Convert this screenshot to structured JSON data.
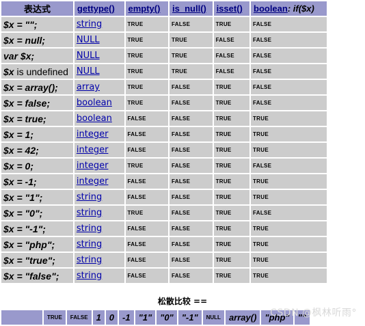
{
  "headers": [
    "表达式",
    "gettype()",
    "empty()",
    "is_null()",
    "isset()",
    "boolean",
    ": if($x)"
  ],
  "rows": [
    {
      "expr": "$x = \"\";",
      "type": "string",
      "empty": "TRUE",
      "is_null": "FALSE",
      "isset": "TRUE",
      "bool": "FALSE"
    },
    {
      "expr": "$x = null;",
      "type": "NULL",
      "empty": "TRUE",
      "is_null": "TRUE",
      "isset": "FALSE",
      "bool": "FALSE"
    },
    {
      "expr": "var $x;",
      "type": "NULL",
      "empty": "TRUE",
      "is_null": "TRUE",
      "isset": "FALSE",
      "bool": "FALSE"
    },
    {
      "expr_var": "$x",
      "expr_rest": " is undefined",
      "type": "NULL",
      "empty": "TRUE",
      "is_null": "TRUE",
      "isset": "FALSE",
      "bool": "FALSE"
    },
    {
      "expr": "$x = array();",
      "type": "array",
      "empty": "TRUE",
      "is_null": "FALSE",
      "isset": "TRUE",
      "bool": "FALSE"
    },
    {
      "expr": "$x = false;",
      "type": "boolean",
      "empty": "TRUE",
      "is_null": "FALSE",
      "isset": "TRUE",
      "bool": "FALSE"
    },
    {
      "expr": "$x = true;",
      "type": "boolean",
      "empty": "FALSE",
      "is_null": "FALSE",
      "isset": "TRUE",
      "bool": "TRUE"
    },
    {
      "expr": "$x = 1;",
      "type": "integer",
      "empty": "FALSE",
      "is_null": "FALSE",
      "isset": "TRUE",
      "bool": "TRUE"
    },
    {
      "expr": "$x = 42;",
      "type": "integer",
      "empty": "FALSE",
      "is_null": "FALSE",
      "isset": "TRUE",
      "bool": "TRUE"
    },
    {
      "expr": "$x = 0;",
      "type": "integer",
      "empty": "TRUE",
      "is_null": "FALSE",
      "isset": "TRUE",
      "bool": "FALSE"
    },
    {
      "expr": "$x = -1;",
      "type": "integer",
      "empty": "FALSE",
      "is_null": "FALSE",
      "isset": "TRUE",
      "bool": "TRUE"
    },
    {
      "expr": "$x = \"1\";",
      "type": "string",
      "empty": "FALSE",
      "is_null": "FALSE",
      "isset": "TRUE",
      "bool": "TRUE"
    },
    {
      "expr": "$x = \"0\";",
      "type": "string",
      "empty": "TRUE",
      "is_null": "FALSE",
      "isset": "TRUE",
      "bool": "FALSE"
    },
    {
      "expr": "$x = \"-1\";",
      "type": "string",
      "empty": "FALSE",
      "is_null": "FALSE",
      "isset": "TRUE",
      "bool": "TRUE"
    },
    {
      "expr": "$x = \"php\";",
      "type": "string",
      "empty": "FALSE",
      "is_null": "FALSE",
      "isset": "TRUE",
      "bool": "TRUE"
    },
    {
      "expr": "$x = \"true\";",
      "type": "string",
      "empty": "FALSE",
      "is_null": "FALSE",
      "isset": "TRUE",
      "bool": "TRUE"
    },
    {
      "expr": "$x = \"false\";",
      "type": "string",
      "empty": "FALSE",
      "is_null": "FALSE",
      "isset": "TRUE",
      "bool": "TRUE"
    }
  ],
  "loose_title": "松散比较 ==",
  "loose_headers": [
    "TRUE",
    "FALSE",
    "1",
    "0",
    "-1",
    "\"1\"",
    "\"0\"",
    "\"-1\"",
    "NULL",
    "array()",
    "\"php\"",
    "\"\""
  ],
  "watermark": "CSDN @枫林听雨°",
  "colors": {
    "header_bg": "#9999cc",
    "cell_bg": "#cccccc",
    "link": "#0000aa"
  }
}
